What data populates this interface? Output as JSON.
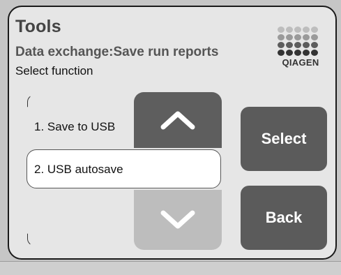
{
  "header": {
    "title": "Tools",
    "subtitle": "Data exchange:Save run reports",
    "instruction": "Select function"
  },
  "logo": {
    "text": "QIAGEN",
    "dot_colors": [
      "#bdbdbd",
      "#9a9a9a",
      "#5c5c5c",
      "#333333"
    ]
  },
  "list": {
    "items": [
      {
        "label": "1. Save to USB",
        "selected": false
      },
      {
        "label": "2. USB autosave",
        "selected": true
      }
    ],
    "scroll_up_icon": "chevron-up-icon",
    "scroll_down_icon": "chevron-down-icon"
  },
  "buttons": {
    "select_label": "Select",
    "back_label": "Back"
  },
  "colors": {
    "screen_bg": "#e6e6e6",
    "button_bg": "#5b5b5b",
    "scroll_up_bg": "#5e5e5e",
    "scroll_down_bg": "#bdbdbd",
    "title_text": "#444444"
  }
}
